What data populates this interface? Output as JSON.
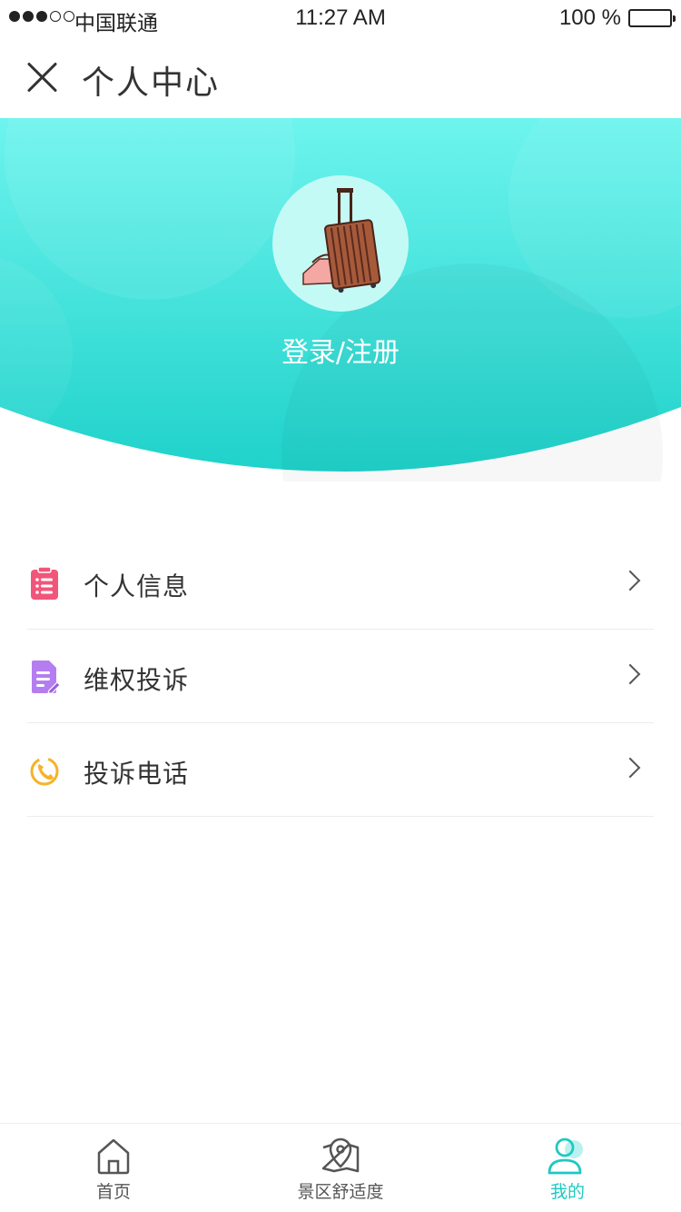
{
  "status_bar": {
    "carrier": "中国联通",
    "time": "11:27 AM",
    "battery": "100 %",
    "signal_strength": 3
  },
  "nav": {
    "title": "个人中心",
    "close_icon": "close-icon"
  },
  "header": {
    "login_label": "登录/注册",
    "avatar_icon": "suitcase-icon",
    "gradient_colors": [
      "#6ef4ee",
      "#1fd2ca"
    ]
  },
  "menu": {
    "items": [
      {
        "label": "个人信息",
        "icon": "clipboard-list-icon",
        "color": "#f2557a"
      },
      {
        "label": "维权投诉",
        "icon": "document-edit-icon",
        "color": "#b57ef0"
      },
      {
        "label": "投诉电话",
        "icon": "phone-icon",
        "color": "#f5b32a"
      }
    ]
  },
  "tabbar": {
    "tabs": [
      {
        "label": "首页",
        "icon": "home-icon",
        "active": false
      },
      {
        "label": "景区舒适度",
        "icon": "map-pin-icon",
        "active": false
      },
      {
        "label": "我的",
        "icon": "user-icon",
        "active": true
      }
    ],
    "active_color": "#1ec9c2"
  }
}
